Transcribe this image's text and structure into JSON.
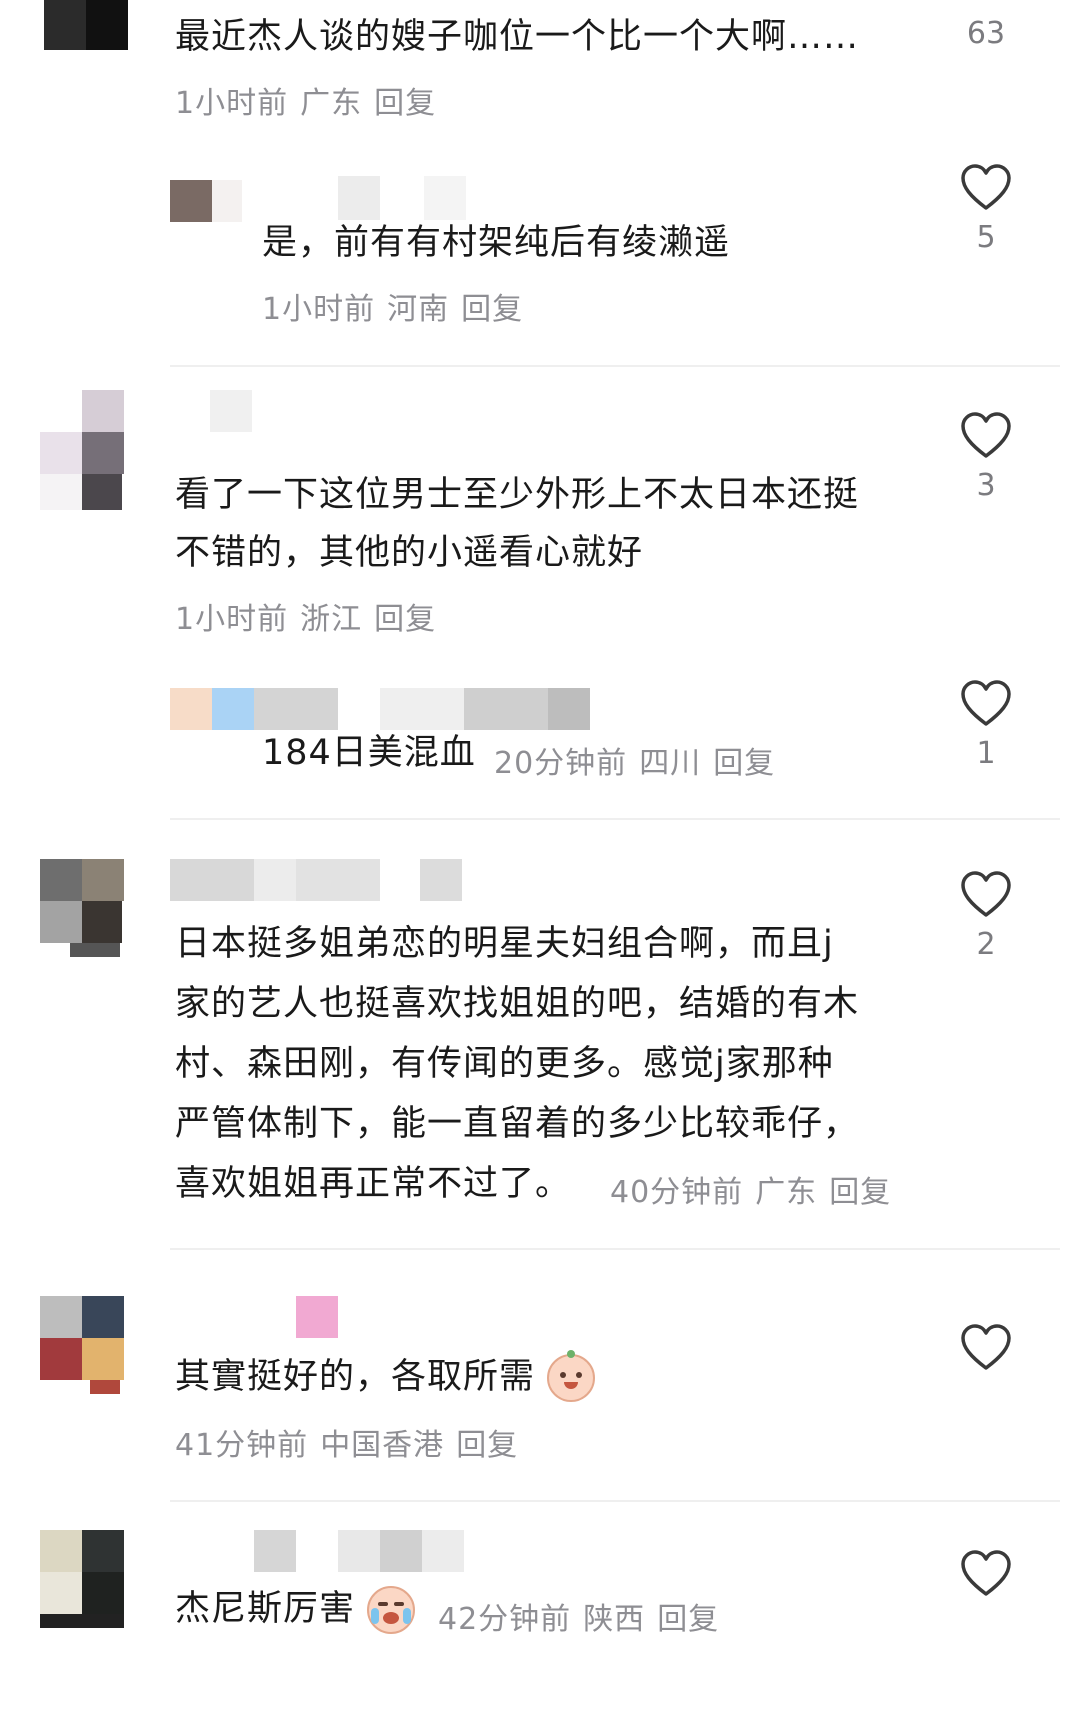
{
  "comments": [
    {
      "text": "最近杰人谈的嫂子咖位一个比一个大啊……",
      "time": "1小时前",
      "location": "广东",
      "reply": "回复",
      "likes": "63"
    },
    {
      "text": "是，前有有村架纯后有绫濑遥",
      "time": "1小时前",
      "location": "河南",
      "reply": "回复",
      "likes": "5"
    },
    {
      "text_line1": "看了一下这位男士至少外形上不太日本还挺",
      "text_line2": "不错的，其他的小遥看心就好",
      "time": "1小时前",
      "location": "浙江",
      "reply": "回复",
      "likes": "3"
    },
    {
      "text": "184日美混血",
      "time": "20分钟前",
      "location": "四川",
      "reply": "回复",
      "likes": "1"
    },
    {
      "text_line1": "日本挺多姐弟恋的明星夫妇组合啊，而且j",
      "text_line2": "家的艺人也挺喜欢找姐姐的吧，结婚的有木",
      "text_line3": "村、森田刚，有传闻的更多。感觉j家那种",
      "text_line4": "严管体制下，能一直留着的多少比较乖仔，",
      "text_line5": "喜欢姐姐再正常不过了。",
      "time": "40分钟前",
      "location": "广东",
      "reply": "回复",
      "likes": "2"
    },
    {
      "text": "其實挺好的，各取所需",
      "time": "41分钟前",
      "location": "中国香港",
      "reply": "回复"
    },
    {
      "text": "杰尼斯厉害",
      "time": "42分钟前",
      "location": "陕西",
      "reply": "回复"
    }
  ],
  "colors": {
    "text": "#1a1a1a",
    "meta": "#8e8e93",
    "divider": "#efefef"
  },
  "icons": [
    "heart-outline-icon",
    "smiling-face-emoji",
    "crying-face-emoji"
  ]
}
